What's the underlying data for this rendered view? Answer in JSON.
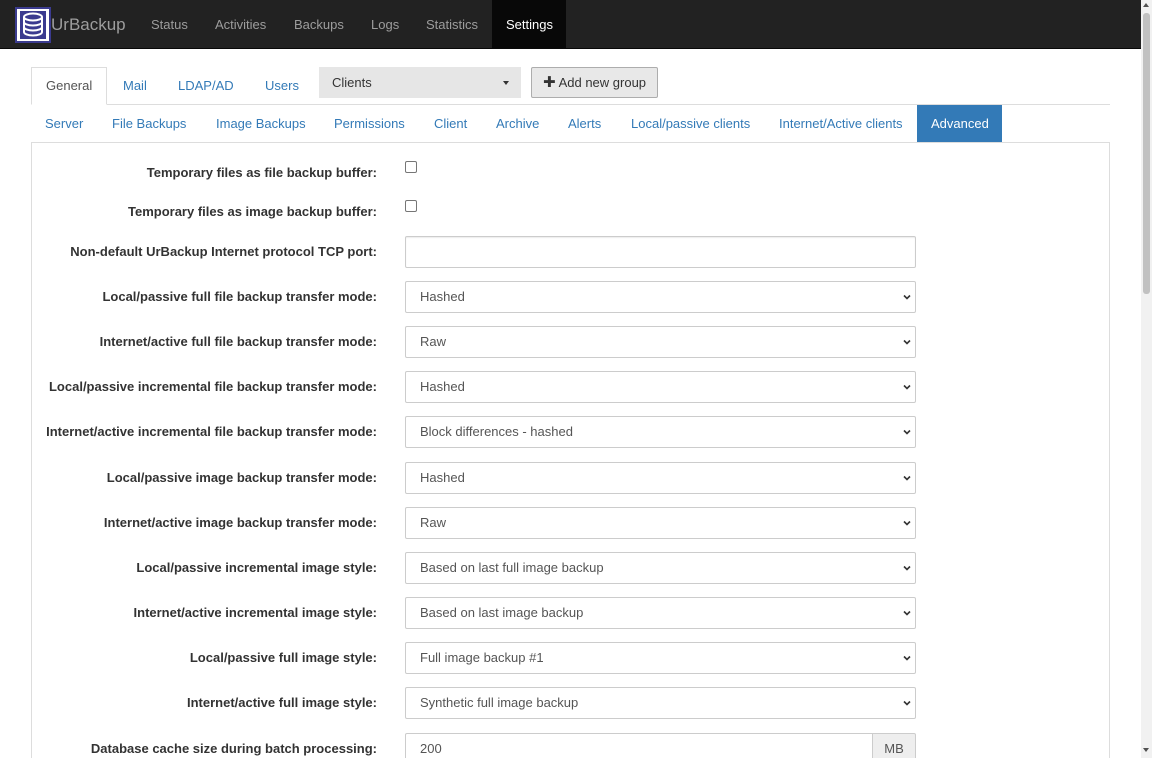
{
  "app": {
    "name": "UrBackup"
  },
  "nav": {
    "items": [
      {
        "label": "Status"
      },
      {
        "label": "Activities"
      },
      {
        "label": "Backups"
      },
      {
        "label": "Logs"
      },
      {
        "label": "Statistics"
      },
      {
        "label": "Settings",
        "active": true
      }
    ]
  },
  "tabs": [
    {
      "label": "General",
      "active": true
    },
    {
      "label": "Mail"
    },
    {
      "label": "LDAP/AD"
    },
    {
      "label": "Users"
    }
  ],
  "group_select": {
    "value": "Clients"
  },
  "add_group_button": {
    "label": "Add new group",
    "icon": "plus-icon"
  },
  "subtabs": [
    {
      "label": "Server"
    },
    {
      "label": "File Backups"
    },
    {
      "label": "Image Backups"
    },
    {
      "label": "Permissions"
    },
    {
      "label": "Client"
    },
    {
      "label": "Archive"
    },
    {
      "label": "Alerts"
    },
    {
      "label": "Local/passive clients"
    },
    {
      "label": "Internet/Active clients"
    },
    {
      "label": "Advanced",
      "active": true
    }
  ],
  "form": {
    "tmp_file_buffer": {
      "label": "Temporary files as file backup buffer:",
      "checked": false
    },
    "tmp_image_buffer": {
      "label": "Temporary files as image backup buffer:",
      "checked": false
    },
    "internet_tcp_port": {
      "label": "Non-default UrBackup Internet protocol TCP port:",
      "value": ""
    },
    "local_full_file_mode": {
      "label": "Local/passive full file backup transfer mode:",
      "value": "Hashed"
    },
    "internet_full_file_mode": {
      "label": "Internet/active full file backup transfer mode:",
      "value": "Raw"
    },
    "local_incr_file_mode": {
      "label": "Local/passive incremental file backup transfer mode:",
      "value": "Hashed"
    },
    "internet_incr_file_mode": {
      "label": "Internet/active incremental file backup transfer mode:",
      "value": "Block differences - hashed"
    },
    "local_image_mode": {
      "label": "Local/passive image backup transfer mode:",
      "value": "Hashed"
    },
    "internet_image_mode": {
      "label": "Internet/active image backup transfer mode:",
      "value": "Raw"
    },
    "local_incr_image_style": {
      "label": "Local/passive incremental image style:",
      "value": "Based on last full image backup"
    },
    "internet_incr_image_style": {
      "label": "Internet/active incremental image style:",
      "value": "Based on last image backup"
    },
    "local_full_image_style": {
      "label": "Local/passive full image style:",
      "value": "Full image backup #1"
    },
    "internet_full_image_style": {
      "label": "Internet/active full image style:",
      "value": "Synthetic full image backup"
    },
    "db_cache_size": {
      "label": "Database cache size during batch processing:",
      "value": "200",
      "unit": "MB"
    }
  },
  "colors": {
    "navbar": "#222222",
    "link": "#337ab7",
    "active_tab": "#337ab7"
  }
}
